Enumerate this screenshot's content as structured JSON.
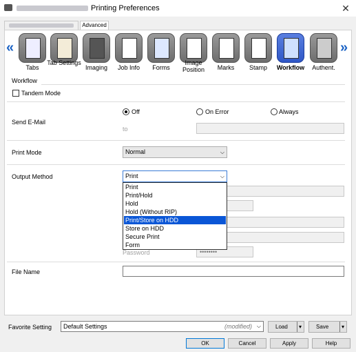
{
  "window": {
    "title": "Printing Preferences",
    "close_glyph": "✕"
  },
  "tabs": {
    "active": "Advanced"
  },
  "nav": {
    "prev": "«",
    "next": "»"
  },
  "toolbar_items": [
    {
      "label": "Tabs",
      "icon": "tabs-icon"
    },
    {
      "label": "Tab Settings",
      "icon": "tab-settings-icon"
    },
    {
      "label": "Imaging",
      "icon": "imaging-icon"
    },
    {
      "label": "Job Info",
      "icon": "job-info-icon"
    },
    {
      "label": "Forms",
      "icon": "forms-icon"
    },
    {
      "label": "Image Position",
      "icon": "image-position-icon"
    },
    {
      "label": "Marks",
      "icon": "marks-icon"
    },
    {
      "label": "Stamp",
      "icon": "stamp-icon"
    },
    {
      "label": "Workflow",
      "icon": "workflow-icon"
    },
    {
      "label": "Authent.",
      "icon": "authentication-icon"
    }
  ],
  "section": {
    "title": "Workflow"
  },
  "tandem": {
    "label": "Tandem Mode",
    "checked": false
  },
  "send_email": {
    "label": "Send E-Mail",
    "options": [
      "Off",
      "On Error",
      "Always"
    ],
    "selected": "Off",
    "to_label": "to"
  },
  "print_mode": {
    "label": "Print Mode",
    "value": "Normal"
  },
  "output_method": {
    "label": "Output Method",
    "value": "Print",
    "options": [
      "Print",
      "Print/Hold",
      "Hold",
      "Hold (Without RIP)",
      "Print/Store on HDD",
      "Store on HDD",
      "Secure Print",
      "Form"
    ],
    "highlighted": "Print/Store on HDD"
  },
  "password": {
    "label": "Password",
    "value": "••••••••"
  },
  "file_name": {
    "label": "File Name",
    "value": ""
  },
  "favorite": {
    "label": "Favorite Setting",
    "value": "Default Settings",
    "status": "(modified)",
    "load": "Load",
    "save": "Save"
  },
  "buttons": {
    "ok": "OK",
    "cancel": "Cancel",
    "apply": "Apply",
    "help": "Help"
  }
}
